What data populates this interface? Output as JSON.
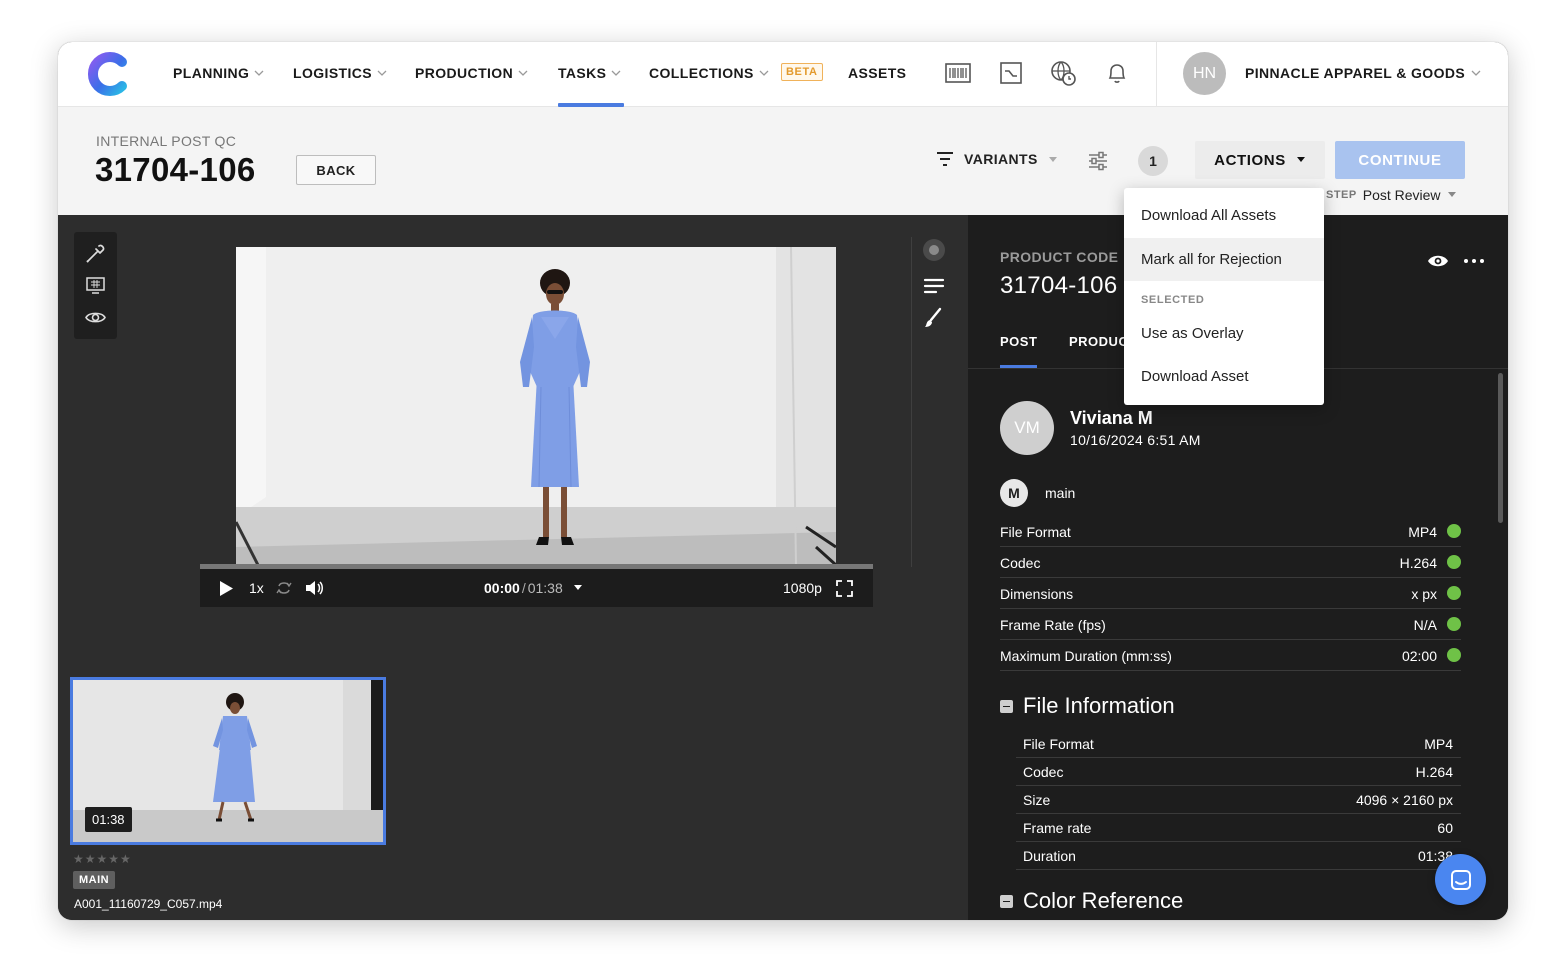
{
  "nav": {
    "items": [
      {
        "label": "PLANNING"
      },
      {
        "label": "LOGISTICS"
      },
      {
        "label": "PRODUCTION"
      },
      {
        "label": "TASKS"
      },
      {
        "label": "COLLECTIONS"
      },
      {
        "label": "ASSETS"
      }
    ],
    "beta_badge": "BETA",
    "active_tab": "TASKS",
    "icons": [
      "barcode-icon",
      "trend-chart-icon",
      "globe-clock-icon",
      "bell-icon"
    ],
    "avatar_initials": "HN",
    "org_name": "PINNACLE APPAREL & GOODS"
  },
  "header": {
    "overline": "INTERNAL POST QC",
    "title": "31704-106",
    "back_label": "BACK",
    "variants_label": "VARIANTS",
    "count": "1",
    "actions_label": "ACTIONS",
    "continue_label": "CONTINUE",
    "next_step_label": "STEP",
    "next_step_value": "Post Review"
  },
  "actions_menu": {
    "items": [
      "Download All Assets",
      "Mark all for Rejection"
    ],
    "selected_section": "SELECTED",
    "selected_items": [
      "Use as Overlay",
      "Download Asset"
    ],
    "hovered": "Mark all for Rejection"
  },
  "player": {
    "speed": "1x",
    "current_time": "00:00",
    "separator": "/",
    "duration": "01:38",
    "quality": "1080p",
    "progress": 0
  },
  "thumbnail": {
    "duration": "01:38",
    "stars": "★★★★★",
    "rating": 0,
    "tag": "MAIN",
    "filename": "A001_11160729_C057.mp4"
  },
  "panel": {
    "product_code_label": "PRODUCT CODE",
    "product_code": "31704-106",
    "tabs": [
      "POST",
      "PRODUC"
    ],
    "active_tab": "POST",
    "user": {
      "initials": "VM",
      "name": "Viviana M",
      "date": "10/16/2024 6:51 AM"
    },
    "asset_badge": "M",
    "asset_label": "main",
    "specs": [
      {
        "key": "File Format",
        "value": "MP4"
      },
      {
        "key": "Codec",
        "value": "H.264"
      },
      {
        "key": "Dimensions",
        "value": "x px"
      },
      {
        "key": "Frame Rate (fps)",
        "value": "N/A"
      },
      {
        "key": "Maximum Duration (mm:ss)",
        "value": "02:00"
      }
    ],
    "file_info_title": "File Information",
    "file_info": [
      {
        "key": "File Format",
        "value": "MP4"
      },
      {
        "key": "Codec",
        "value": "H.264"
      },
      {
        "key": "Size",
        "value": "4096 × 2160 px"
      },
      {
        "key": "Frame rate",
        "value": "60"
      },
      {
        "key": "Duration",
        "value": "01:38"
      }
    ],
    "color_ref_title": "Color Reference"
  },
  "colors": {
    "accent": "#4a7be0",
    "continue_disabled": "#a9c3ef",
    "ok_green": "#6fc247",
    "beta_orange": "#e39a2d",
    "panel_bg": "#1d1d1d",
    "stage_bg": "#2d2d2d",
    "dress_blue": "#7f9ee6"
  }
}
